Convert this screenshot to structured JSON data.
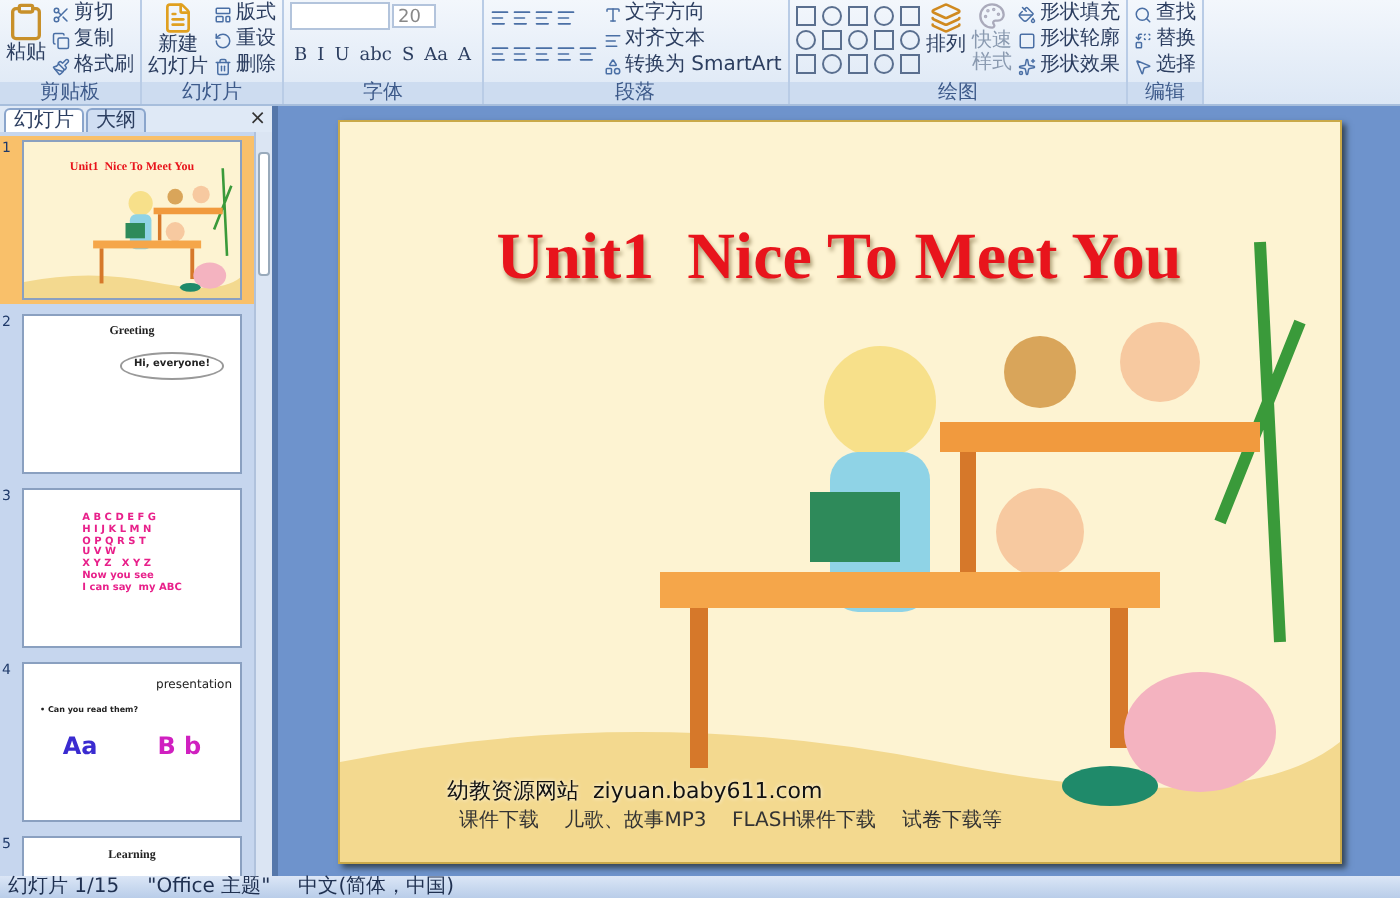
{
  "ribbon": {
    "groups": [
      {
        "kind": "clipboard",
        "label": "剪贴板",
        "big": "粘贴",
        "items": [
          "剪切",
          "复制",
          "格式刷"
        ]
      },
      {
        "kind": "slides",
        "label": "幻灯片",
        "big": [
          "新建",
          "幻灯片"
        ],
        "items": [
          "版式",
          "重设",
          "删除"
        ]
      },
      {
        "kind": "font",
        "label": "字体",
        "size": "20",
        "buttons": [
          "B",
          "I",
          "U",
          "abc",
          "S",
          "Aa",
          "A"
        ]
      },
      {
        "kind": "paragraph",
        "label": "段落",
        "items": [
          "文字方向",
          "对齐文本",
          "转换为 SmartArt"
        ]
      },
      {
        "kind": "drawing",
        "label": "绘图",
        "big": [
          "排列"
        ],
        "quick": [
          "快速",
          "样式"
        ],
        "items": [
          "形状填充",
          "形状轮廓",
          "形状效果"
        ]
      },
      {
        "kind": "editing",
        "label": "编辑",
        "items": [
          "查找",
          "替换",
          "选择"
        ]
      }
    ]
  },
  "sidebar": {
    "tabs": [
      {
        "label": "幻灯片",
        "selected": true
      },
      {
        "label": "大纲",
        "selected": false
      }
    ],
    "close": "×",
    "slides": [
      {
        "number": "1",
        "kind": "title",
        "selected": true,
        "texts": [
          "Unit1  Nice To Meet You"
        ]
      },
      {
        "number": "2",
        "kind": "greeting",
        "selected": false,
        "texts": [
          "Greeting",
          "Hi, everyone!"
        ]
      },
      {
        "number": "3",
        "kind": "alphabet",
        "selected": false,
        "texts": [
          "A B C D E F G",
          "H I J K L M N",
          "O P Q R S T",
          "U V W",
          "X Y Z   X Y Z",
          "Now you see",
          "I can say  my ABC"
        ]
      },
      {
        "number": "4",
        "kind": "presentation",
        "selected": false,
        "texts": [
          "presentation",
          "• Can you read them?",
          "Aa",
          "B b"
        ]
      },
      {
        "number": "5",
        "kind": "learning",
        "selected": false,
        "texts": [
          "Learning"
        ]
      }
    ]
  },
  "slide": {
    "title": "Unit1  Nice To Meet You",
    "site": "幼教资源网站  ziyuan.baby611.com",
    "tagline": "课件下载    儿歌、故事MP3    FLASH课件下载    试卷下载等"
  },
  "status_bar": [
    "幻灯片 1/15",
    "\"Office 主题\"",
    "中文(简体，中国)"
  ]
}
